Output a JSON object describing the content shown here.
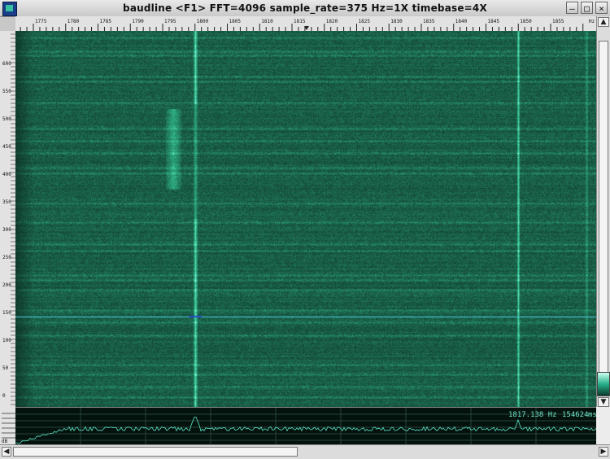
{
  "window": {
    "title": "baudline  <F1> FFT=4096 sample_rate=375 Hz=1X timebase=4X",
    "buttons": {
      "minimize": "–",
      "maximize": "□",
      "close": "×"
    }
  },
  "freq_axis": {
    "ticks": [
      "1775",
      "1780",
      "1785",
      "1790",
      "1795",
      "1800",
      "1805",
      "1810",
      "1815",
      "1820",
      "1825",
      "1830",
      "1835",
      "1840",
      "1845",
      "1850",
      "1855"
    ],
    "unit": "Hz"
  },
  "time_axis": {
    "labels": [
      "600",
      "550",
      "500",
      "450",
      "400",
      "350",
      "300",
      "250",
      "200",
      "150",
      "100",
      "50",
      "0"
    ]
  },
  "spectrogram": {
    "colors": {
      "background": "#0d3b30",
      "signal": "#2fe0a8",
      "strong": "#7ffce0"
    },
    "carriers_hz": [
      1800,
      1850
    ],
    "cursor_time_label": "0"
  },
  "spectrum": {
    "db_label": "dB",
    "readout_freq": "1817.138 Hz",
    "readout_count": "154624",
    "readout_unit": "ms"
  },
  "scrollbars": {
    "up": "▲",
    "down": "▼",
    "left": "◀",
    "right": "▶"
  }
}
